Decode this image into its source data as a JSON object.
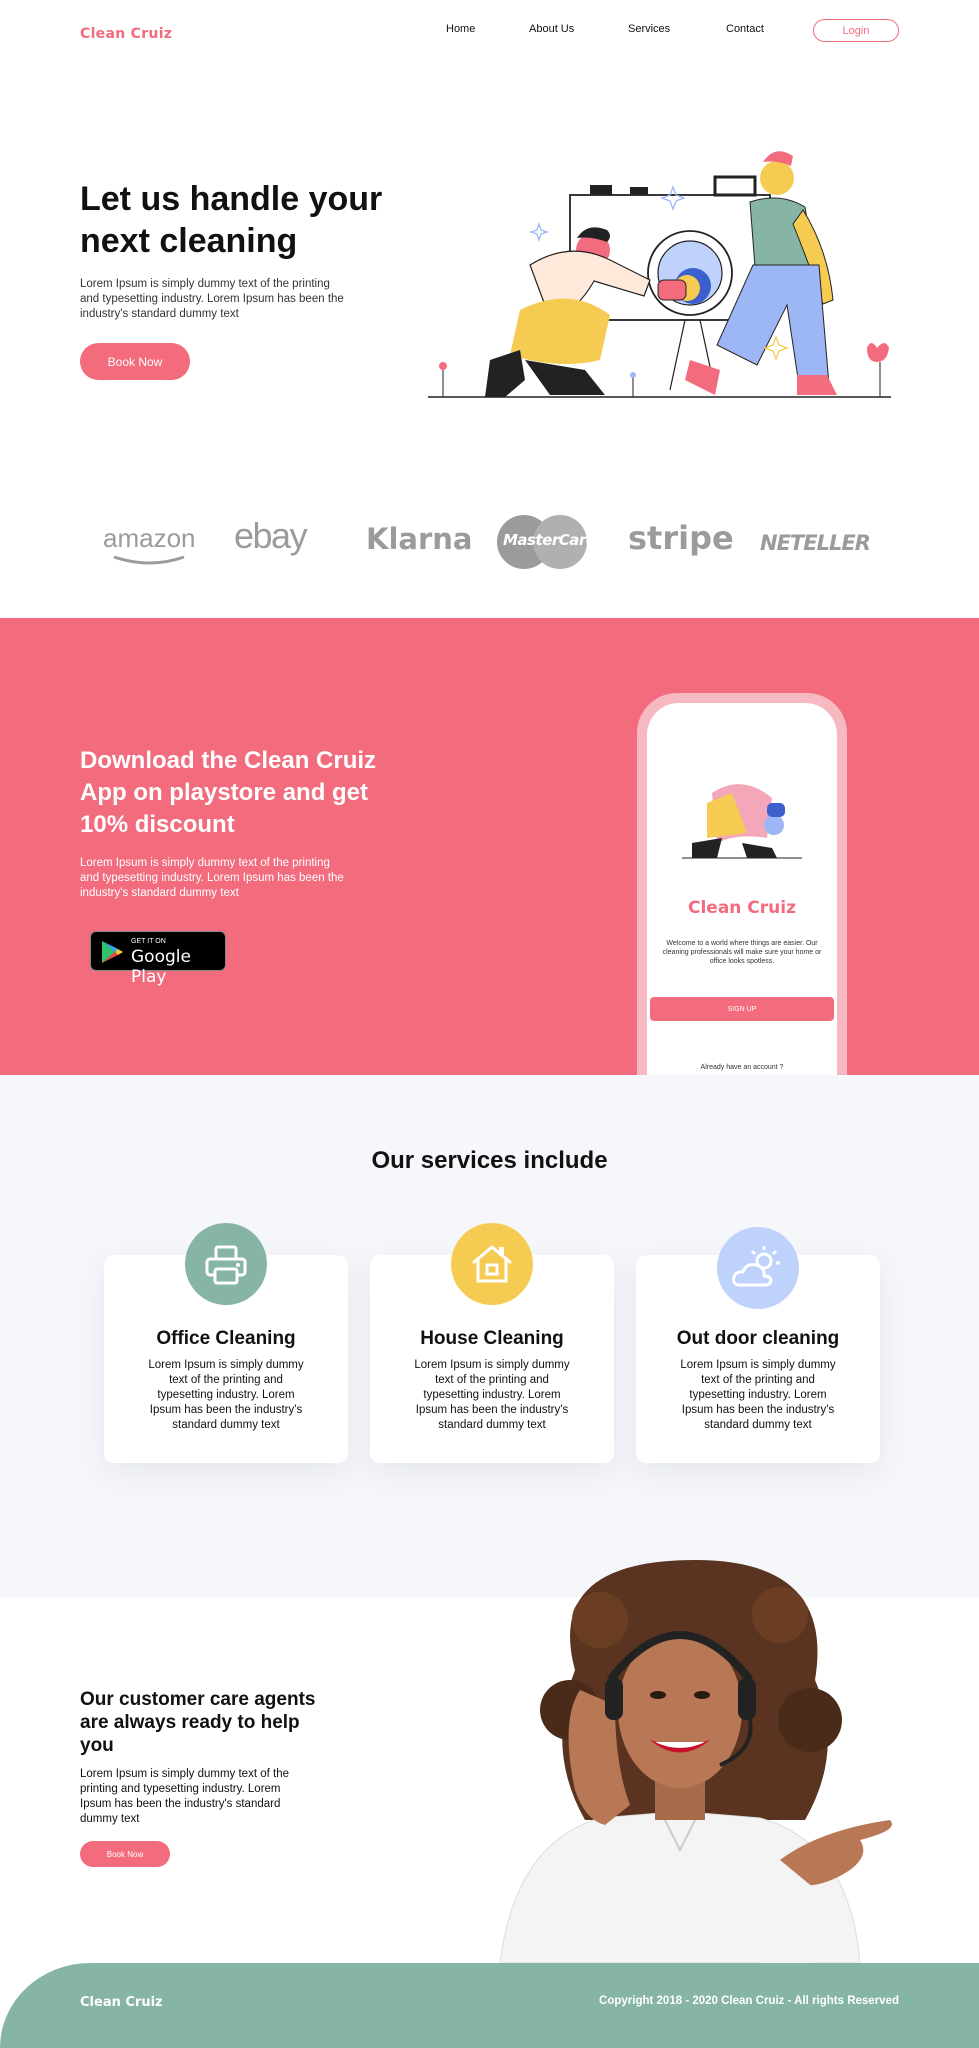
{
  "brand": "Clean Cruiz",
  "colors": {
    "accent": "#F26C7E",
    "teal": "#86B5A5",
    "yellow": "#F6CB52",
    "blue": "#BED2FB"
  },
  "nav": {
    "items": [
      {
        "label": "Home"
      },
      {
        "label": "About Us"
      },
      {
        "label": "Services"
      },
      {
        "label": "Contact"
      }
    ],
    "login": "Login"
  },
  "hero": {
    "title": "Let us handle your next cleaning",
    "text": "Lorem Ipsum is simply dummy text of the printing and typesetting industry. Lorem Ipsum has been the industry's standard dummy text",
    "button": "Book Now"
  },
  "brands": [
    "amazon",
    "ebay",
    "Klarna",
    "MasterCard",
    "stripe",
    "NETELLER"
  ],
  "download": {
    "title": "Download the Clean Cruiz App on playstore and get 10% discount",
    "text": "Lorem Ipsum is simply dummy text of the printing and typesetting industry. Lorem Ipsum has been the industry's standard dummy text",
    "store_small": "GET IT ON",
    "store_big": "Google Play",
    "phone": {
      "brand": "Clean Cruiz",
      "desc": "Welcome to a world where things are easier. Our cleaning professionals will make sure your home or office looks spotless.",
      "signup": "SIGN UP",
      "already": "Already have an account ?"
    }
  },
  "services": {
    "title": "Our services include",
    "cards": [
      {
        "title": "Office Cleaning",
        "text": "Lorem Ipsum is simply dummy text of the printing and typesetting industry. Lorem Ipsum has been the industry's standard dummy text",
        "icon": "printer-icon",
        "color": "#86B5A5"
      },
      {
        "title": "House Cleaning",
        "text": "Lorem Ipsum is simply dummy text of the printing and typesetting industry. Lorem Ipsum has been the industry's standard dummy text",
        "icon": "house-icon",
        "color": "#F6CB52"
      },
      {
        "title": "Out door cleaning",
        "text": "Lorem Ipsum is simply dummy text of the printing and typesetting industry. Lorem Ipsum has been the industry's standard dummy text",
        "icon": "sun-cloud-icon",
        "color": "#BED2FB"
      }
    ]
  },
  "care": {
    "title": "Our customer care agents are always ready to help you",
    "text": "Lorem Ipsum is simply dummy text of the printing and typesetting industry. Lorem Ipsum has been the industry's standard dummy text",
    "button": "Book Now"
  },
  "footer": {
    "logo": "Clean Cruiz",
    "copyright": "Copyright 2018 - 2020 Clean Cruiz - All rights Reserved"
  }
}
